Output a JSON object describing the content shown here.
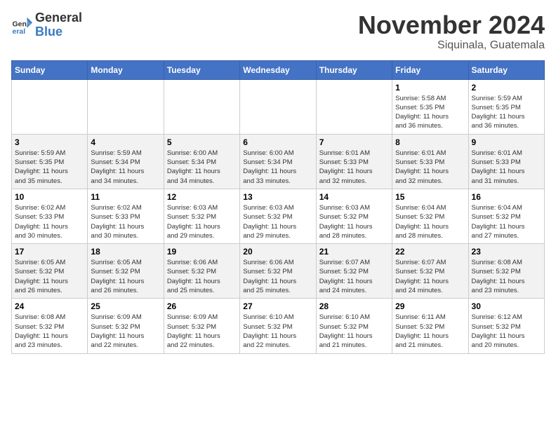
{
  "header": {
    "logo_general": "General",
    "logo_blue": "Blue",
    "month_title": "November 2024",
    "location": "Siquinala, Guatemala"
  },
  "calendar": {
    "weekdays": [
      "Sunday",
      "Monday",
      "Tuesday",
      "Wednesday",
      "Thursday",
      "Friday",
      "Saturday"
    ],
    "weeks": [
      [
        {
          "day": "",
          "info": ""
        },
        {
          "day": "",
          "info": ""
        },
        {
          "day": "",
          "info": ""
        },
        {
          "day": "",
          "info": ""
        },
        {
          "day": "",
          "info": ""
        },
        {
          "day": "1",
          "info": "Sunrise: 5:58 AM\nSunset: 5:35 PM\nDaylight: 11 hours\nand 36 minutes."
        },
        {
          "day": "2",
          "info": "Sunrise: 5:59 AM\nSunset: 5:35 PM\nDaylight: 11 hours\nand 36 minutes."
        }
      ],
      [
        {
          "day": "3",
          "info": "Sunrise: 5:59 AM\nSunset: 5:35 PM\nDaylight: 11 hours\nand 35 minutes."
        },
        {
          "day": "4",
          "info": "Sunrise: 5:59 AM\nSunset: 5:34 PM\nDaylight: 11 hours\nand 34 minutes."
        },
        {
          "day": "5",
          "info": "Sunrise: 6:00 AM\nSunset: 5:34 PM\nDaylight: 11 hours\nand 34 minutes."
        },
        {
          "day": "6",
          "info": "Sunrise: 6:00 AM\nSunset: 5:34 PM\nDaylight: 11 hours\nand 33 minutes."
        },
        {
          "day": "7",
          "info": "Sunrise: 6:01 AM\nSunset: 5:33 PM\nDaylight: 11 hours\nand 32 minutes."
        },
        {
          "day": "8",
          "info": "Sunrise: 6:01 AM\nSunset: 5:33 PM\nDaylight: 11 hours\nand 32 minutes."
        },
        {
          "day": "9",
          "info": "Sunrise: 6:01 AM\nSunset: 5:33 PM\nDaylight: 11 hours\nand 31 minutes."
        }
      ],
      [
        {
          "day": "10",
          "info": "Sunrise: 6:02 AM\nSunset: 5:33 PM\nDaylight: 11 hours\nand 30 minutes."
        },
        {
          "day": "11",
          "info": "Sunrise: 6:02 AM\nSunset: 5:33 PM\nDaylight: 11 hours\nand 30 minutes."
        },
        {
          "day": "12",
          "info": "Sunrise: 6:03 AM\nSunset: 5:32 PM\nDaylight: 11 hours\nand 29 minutes."
        },
        {
          "day": "13",
          "info": "Sunrise: 6:03 AM\nSunset: 5:32 PM\nDaylight: 11 hours\nand 29 minutes."
        },
        {
          "day": "14",
          "info": "Sunrise: 6:03 AM\nSunset: 5:32 PM\nDaylight: 11 hours\nand 28 minutes."
        },
        {
          "day": "15",
          "info": "Sunrise: 6:04 AM\nSunset: 5:32 PM\nDaylight: 11 hours\nand 28 minutes."
        },
        {
          "day": "16",
          "info": "Sunrise: 6:04 AM\nSunset: 5:32 PM\nDaylight: 11 hours\nand 27 minutes."
        }
      ],
      [
        {
          "day": "17",
          "info": "Sunrise: 6:05 AM\nSunset: 5:32 PM\nDaylight: 11 hours\nand 26 minutes."
        },
        {
          "day": "18",
          "info": "Sunrise: 6:05 AM\nSunset: 5:32 PM\nDaylight: 11 hours\nand 26 minutes."
        },
        {
          "day": "19",
          "info": "Sunrise: 6:06 AM\nSunset: 5:32 PM\nDaylight: 11 hours\nand 25 minutes."
        },
        {
          "day": "20",
          "info": "Sunrise: 6:06 AM\nSunset: 5:32 PM\nDaylight: 11 hours\nand 25 minutes."
        },
        {
          "day": "21",
          "info": "Sunrise: 6:07 AM\nSunset: 5:32 PM\nDaylight: 11 hours\nand 24 minutes."
        },
        {
          "day": "22",
          "info": "Sunrise: 6:07 AM\nSunset: 5:32 PM\nDaylight: 11 hours\nand 24 minutes."
        },
        {
          "day": "23",
          "info": "Sunrise: 6:08 AM\nSunset: 5:32 PM\nDaylight: 11 hours\nand 23 minutes."
        }
      ],
      [
        {
          "day": "24",
          "info": "Sunrise: 6:08 AM\nSunset: 5:32 PM\nDaylight: 11 hours\nand 23 minutes."
        },
        {
          "day": "25",
          "info": "Sunrise: 6:09 AM\nSunset: 5:32 PM\nDaylight: 11 hours\nand 22 minutes."
        },
        {
          "day": "26",
          "info": "Sunrise: 6:09 AM\nSunset: 5:32 PM\nDaylight: 11 hours\nand 22 minutes."
        },
        {
          "day": "27",
          "info": "Sunrise: 6:10 AM\nSunset: 5:32 PM\nDaylight: 11 hours\nand 22 minutes."
        },
        {
          "day": "28",
          "info": "Sunrise: 6:10 AM\nSunset: 5:32 PM\nDaylight: 11 hours\nand 21 minutes."
        },
        {
          "day": "29",
          "info": "Sunrise: 6:11 AM\nSunset: 5:32 PM\nDaylight: 11 hours\nand 21 minutes."
        },
        {
          "day": "30",
          "info": "Sunrise: 6:12 AM\nSunset: 5:32 PM\nDaylight: 11 hours\nand 20 minutes."
        }
      ]
    ]
  }
}
